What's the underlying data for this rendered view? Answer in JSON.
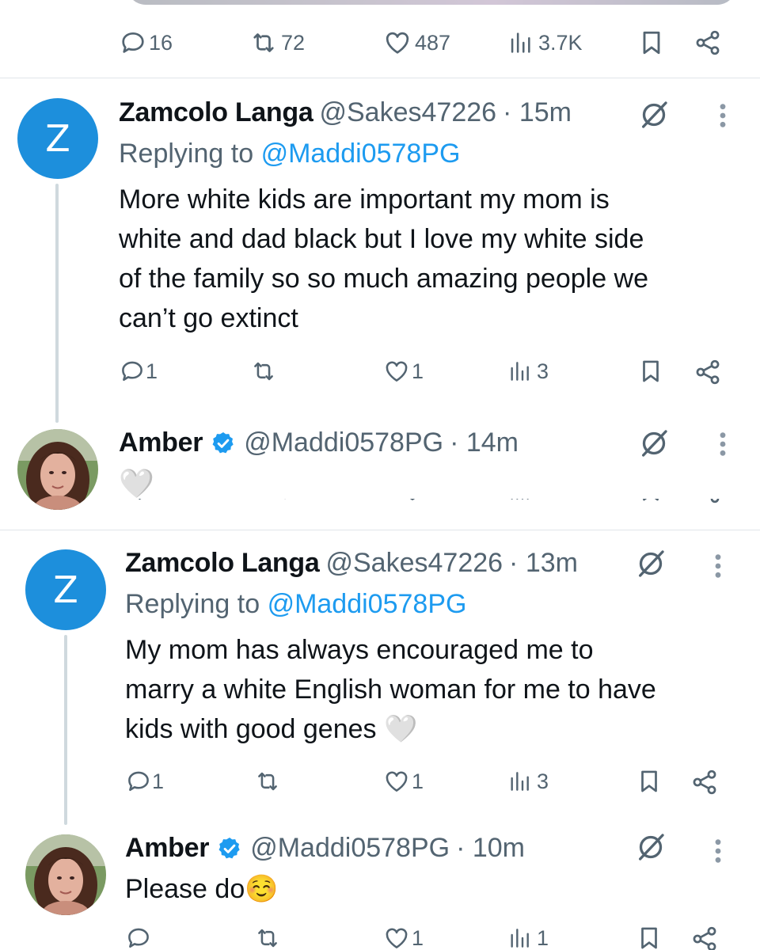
{
  "top_tweet": {
    "actions": {
      "replies": "16",
      "reposts": "72",
      "likes": "487",
      "views": "3.7K"
    }
  },
  "replies": [
    {
      "avatar_letter": "Z",
      "name": "Zamcolo Langa",
      "handle": "@Sakes47226",
      "time": "· 15m",
      "replying_label": "Replying to",
      "replying_to": "@Maddi0578PG",
      "text_lines": [
        "More white kids are important my mom is",
        "white and dad black but I love my white side",
        "of the family so so much amazing people we",
        "can’t go extinct"
      ],
      "actions": {
        "replies": "1",
        "reposts": "",
        "likes": "1",
        "views": "3"
      }
    },
    {
      "name": "Amber",
      "handle": "@Maddi0578PG",
      "time": "· 14m",
      "text": "🤍",
      "verified": true
    },
    {
      "avatar_letter": "Z",
      "name": "Zamcolo Langa",
      "handle": "@Sakes47226",
      "time": "· 13m",
      "replying_label": "Replying to",
      "replying_to": "@Maddi0578PG",
      "text_lines": [
        "My mom has always encouraged me to",
        "marry a white English woman for me to have",
        "kids with good genes 🤍"
      ],
      "actions": {
        "replies": "1",
        "reposts": "",
        "likes": "1",
        "views": "3"
      }
    },
    {
      "name": "Amber",
      "handle": "@Maddi0578PG",
      "time": "· 10m",
      "text": "Please do☺️",
      "verified": true,
      "actions": {
        "replies": "",
        "reposts": "",
        "likes": "1",
        "views": "1"
      }
    }
  ],
  "colors": {
    "accent": "#1d9bf0",
    "avatar_z": "#1d8fdc",
    "muted": "#536471",
    "text": "#0f1419"
  },
  "icons": [
    "reply-icon",
    "repost-icon",
    "like-icon",
    "views-icon",
    "bookmark-icon",
    "share-icon",
    "grok-icon",
    "more-icon",
    "verified-icon"
  ]
}
